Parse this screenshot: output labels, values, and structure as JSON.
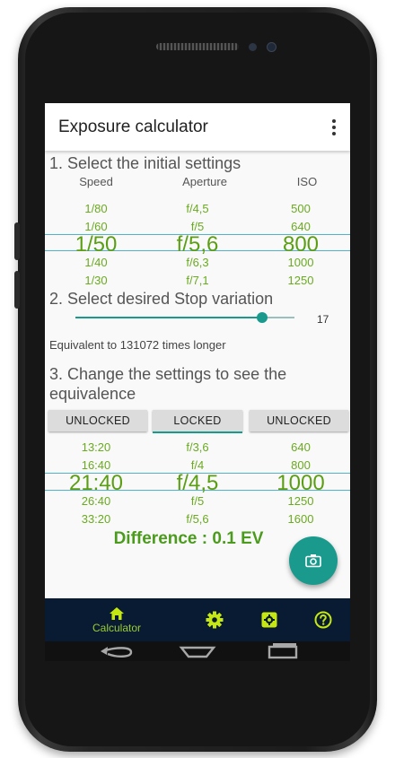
{
  "app": {
    "title": "Exposure calculator"
  },
  "section1": {
    "title": "1. Select the initial settings",
    "headers": [
      "Speed",
      "Aperture",
      "ISO"
    ],
    "speed": [
      "1/80",
      "1/60",
      "1/50",
      "1/40",
      "1/30"
    ],
    "aperture": [
      "f/4,5",
      "f/5",
      "f/5,6",
      "f/6,3",
      "f/7,1"
    ],
    "iso": [
      "500",
      "640",
      "800",
      "1000",
      "1250"
    ]
  },
  "section2": {
    "title": "2. Select desired Stop variation",
    "slider_value": "17",
    "slider_fraction": 0.85,
    "equivalent": "Equivalent to 131072 times longer"
  },
  "section3": {
    "title": "3. Change the settings to see the equivalence",
    "buttons": [
      "UNLOCKED",
      "LOCKED",
      "UNLOCKED"
    ],
    "speed": [
      "13:20",
      "16:40",
      "21:40",
      "26:40",
      "33:20"
    ],
    "aperture": [
      "f/3,6",
      "f/4",
      "f/4,5",
      "f/5",
      "f/5,6"
    ],
    "iso": [
      "640",
      "800",
      "1000",
      "1250",
      "1600"
    ]
  },
  "difference": "Difference : 0.1 EV",
  "bottom_nav": {
    "calculator_label": "Calculator"
  },
  "colors": {
    "accent": "#1a9a8d",
    "value_green": "#6aaa1f",
    "nav_bg": "#091a33",
    "nav_icon": "#c6e812"
  }
}
